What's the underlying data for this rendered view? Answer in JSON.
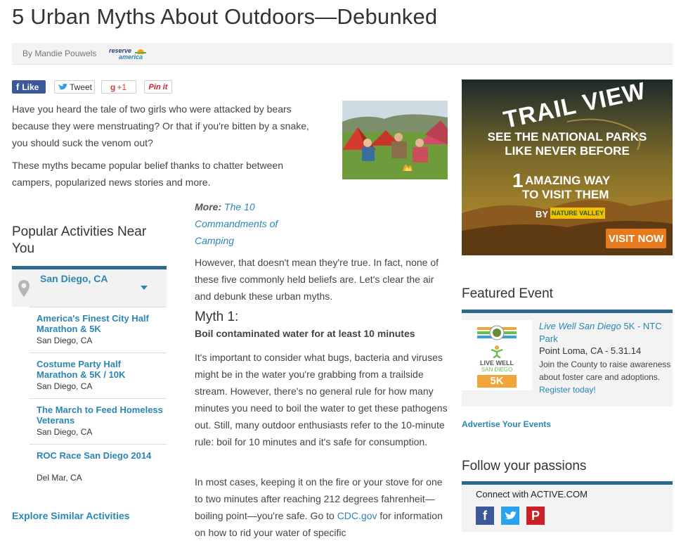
{
  "article": {
    "title": "5 Urban Myths About Outdoors—Debunked",
    "byline": "By Mandie Pouwels",
    "logo_top": "reserve",
    "logo_bottom": "america"
  },
  "social": {
    "like": "Like",
    "tweet": "Tweet",
    "gplus": "+1",
    "pin": "Pin it"
  },
  "intro": {
    "p1": "Have you heard the tale of two girls who were attacked by bears because they were menstruating? Or that if you're bitten by a snake, you should suck the venom out?",
    "p2": "These myths became popular belief thanks to chatter between campers, popularized news stories and more."
  },
  "more": {
    "label": "More:",
    "link": "The 10 Commandments of Camping"
  },
  "body": {
    "p3": "However, that doesn't mean they're true. In fact, none of these five commonly held beliefs are. Let's clear the air and debunk these urban myths.",
    "myth1_title": "Myth 1:",
    "myth1_sub": "Boil contaminated water for at least 10 minutes",
    "p4": "It's important to consider what bugs, bacteria and viruses might be in the water you're grabbing from a trailside stream. However, there's no general rule for how many minutes you need to boil the water to get these pathogens out. Still, many outdoor enthusiasts refer to the 10-minute rule: boil for 10 minutes and it's safe for consumption.",
    "p5_start": "In most cases, keeping it on the fire or your stove for one to two minutes after reaching 212 degrees fahrenheit—boiling point—you're safe. Go to ",
    "p5_link": "CDC.gov",
    "p5_end": " for information on how to rid your water of specific"
  },
  "popular": {
    "title": "Popular Activities Near You",
    "location": "San Diego, CA",
    "events": [
      {
        "name": "America's Finest City Half Marathon & 5K",
        "place": "San Diego, CA"
      },
      {
        "name": "Costume Party Half Marathon & 5K / 10K",
        "place": "San Diego, CA"
      },
      {
        "name": "The March to Feed Homeless Veterans",
        "place": "San Diego, CA"
      },
      {
        "name": "ROC Race San Diego 2014",
        "place": "Del Mar, CA"
      }
    ],
    "explore": "Explore Similar Activities"
  },
  "ad": {
    "headline": "TRAIL VIEW",
    "line1": "SEE THE NATIONAL PARKS",
    "line2": "LIKE NEVER BEFORE",
    "line3a": "AMAZING WAY",
    "line3num": "1",
    "line4": "TO VISIT THEM",
    "by": "BY",
    "brand": "NATURE VALLEY",
    "cta": "VISIT NOW"
  },
  "featured": {
    "title": "Featured Event",
    "event_name": "Live Well San Diego",
    "event_rest": " 5K - NTC Park",
    "event_meta": "Point Loma, CA - 5.31.14",
    "desc": "Join the County to raise awareness about foster care and adoptions. ",
    "register": "Register today!",
    "logo_line1": "LIVE WELL",
    "logo_line2": "SAN DIEGO",
    "logo_line3": "5K",
    "advertise": "Advertise Your Events"
  },
  "follow": {
    "title": "Follow your passions",
    "connect": "Connect with ACTIVE.COM"
  }
}
